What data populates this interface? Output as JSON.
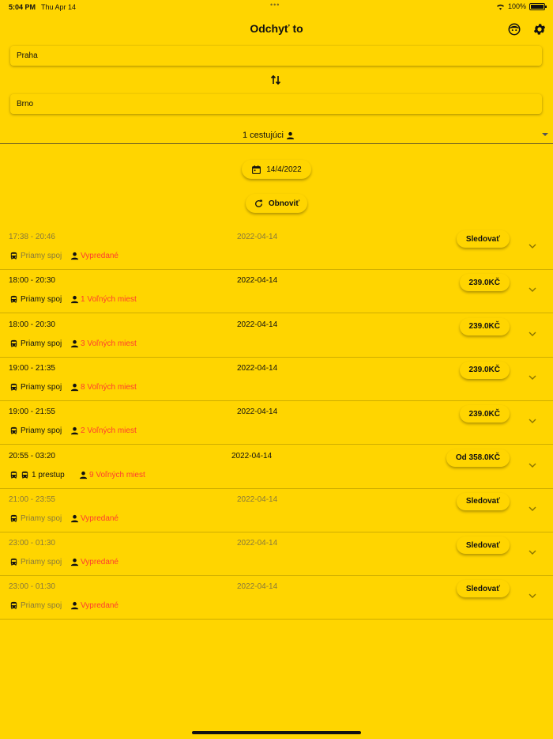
{
  "status": {
    "time": "5:04 PM",
    "date": "Thu Apr 14",
    "battery": "100%"
  },
  "app": {
    "title": "Odchyť to"
  },
  "search": {
    "from": "Praha",
    "to": "Brno",
    "passengers": "1 cestujúci"
  },
  "date_button": "14/4/2022",
  "refresh_button": "Obnoviť",
  "rows": [
    {
      "times": "17:38 - 20:46",
      "date": "2022-04-14",
      "type": "Priamy spoj",
      "seats": "Vypredané",
      "action": "Sledovať",
      "dim": true
    },
    {
      "times": "18:00 - 20:30",
      "date": "2022-04-14",
      "type": "Priamy spoj",
      "seats": "1 Voľných miest",
      "action": "239.0KČ",
      "dim": false
    },
    {
      "times": "18:00 - 20:30",
      "date": "2022-04-14",
      "type": "Priamy spoj",
      "seats": "3 Voľných miest",
      "action": "239.0KČ",
      "dim": false
    },
    {
      "times": "19:00 - 21:35",
      "date": "2022-04-14",
      "type": "Priamy spoj",
      "seats": "8 Voľných miest",
      "action": "239.0KČ",
      "dim": false
    },
    {
      "times": "19:00 - 21:55",
      "date": "2022-04-14",
      "type": "Priamy spoj",
      "seats": "2 Voľných miest",
      "action": "239.0KČ",
      "dim": false
    },
    {
      "times": "20:55 - 03:20",
      "date": "2022-04-14",
      "type": "1 prestup",
      "seats": "9 Voľných miest",
      "action": "Od 358.0KČ",
      "dim": false
    },
    {
      "times": "21:00 - 23:55",
      "date": "2022-04-14",
      "type": "Priamy spoj",
      "seats": "Vypredané",
      "action": "Sledovať",
      "dim": true
    },
    {
      "times": "23:00 - 01:30",
      "date": "2022-04-14",
      "type": "Priamy spoj",
      "seats": "Vypredané",
      "action": "Sledovať",
      "dim": true
    },
    {
      "times": "23:00 - 01:30",
      "date": "2022-04-14",
      "type": "Priamy spoj",
      "seats": "Vypredané",
      "action": "Sledovať",
      "dim": true
    }
  ]
}
